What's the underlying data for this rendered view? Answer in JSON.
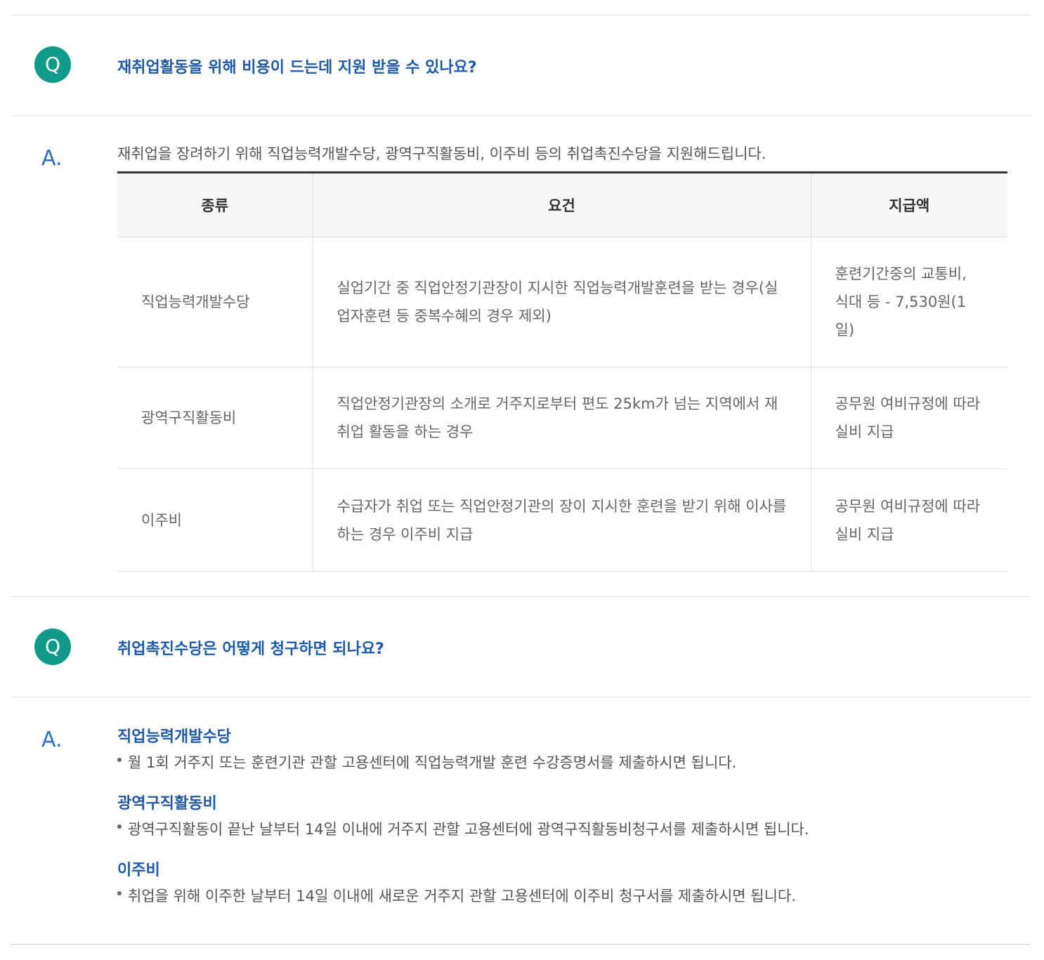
{
  "faq1": {
    "question": "재취업활동을 위해 비용이 드는데 지원 받을 수 있나요?",
    "q_mark": "Q",
    "a_mark": "A.",
    "answer_intro": "재취업을 장려하기 위해 직업능력개발수당, 광역구직활동비, 이주비 등의 취업촉진수당을 지원해드립니다.",
    "table": {
      "headers": [
        "종류",
        "요건",
        "지급액"
      ],
      "rows": [
        {
          "type": "직업능력개발수당",
          "requirement": "실업기간 중 직업안정기관장이 지시한 직업능력개발훈련을 받는 경우(실업자훈련 등 중복수혜의 경우 제외)",
          "amount": "훈련기간중의 교통비, 식대 등 - 7,530원(1일)"
        },
        {
          "type": "광역구직활동비",
          "requirement": "직업안정기관장의 소개로 거주지로부터 편도 25km가 넘는 지역에서 재취업 활동을 하는 경우",
          "amount": "공무원 여비규정에 따라 실비 지급"
        },
        {
          "type": "이주비",
          "requirement": "수급자가 취업 또는 직업안정기관의 장이 지시한 훈련을 받기 위해 이사를 하는 경우 이주비 지급",
          "amount": "공무원 여비규정에 따라 실비 지급"
        }
      ]
    }
  },
  "faq2": {
    "question": "취업촉진수당은 어떻게 청구하면 되나요?",
    "q_mark": "Q",
    "a_mark": "A.",
    "items": [
      {
        "title": "직업능력개발수당",
        "text": "월 1회 거주지 또는 훈련기관 관할 고용센터에 직업능력개발 훈련 수강증명서를 제출하시면 됩니다."
      },
      {
        "title": "광역구직활동비",
        "text": "광역구직활동이 끝난 날부터 14일 이내에 거주지 관할 고용센터에 광역구직활동비청구서를 제출하시면 됩니다."
      },
      {
        "title": "이주비",
        "text": "취업을 위해 이주한 날부터 14일 이내에 새로운 거주지 관할 고용센터에 이주비 청구서를 제출하시면 됩니다."
      }
    ]
  },
  "colors": {
    "q_badge": "#0f9a8a",
    "question_text": "#1f5aa8",
    "a_mark": "#2f6fbf"
  }
}
